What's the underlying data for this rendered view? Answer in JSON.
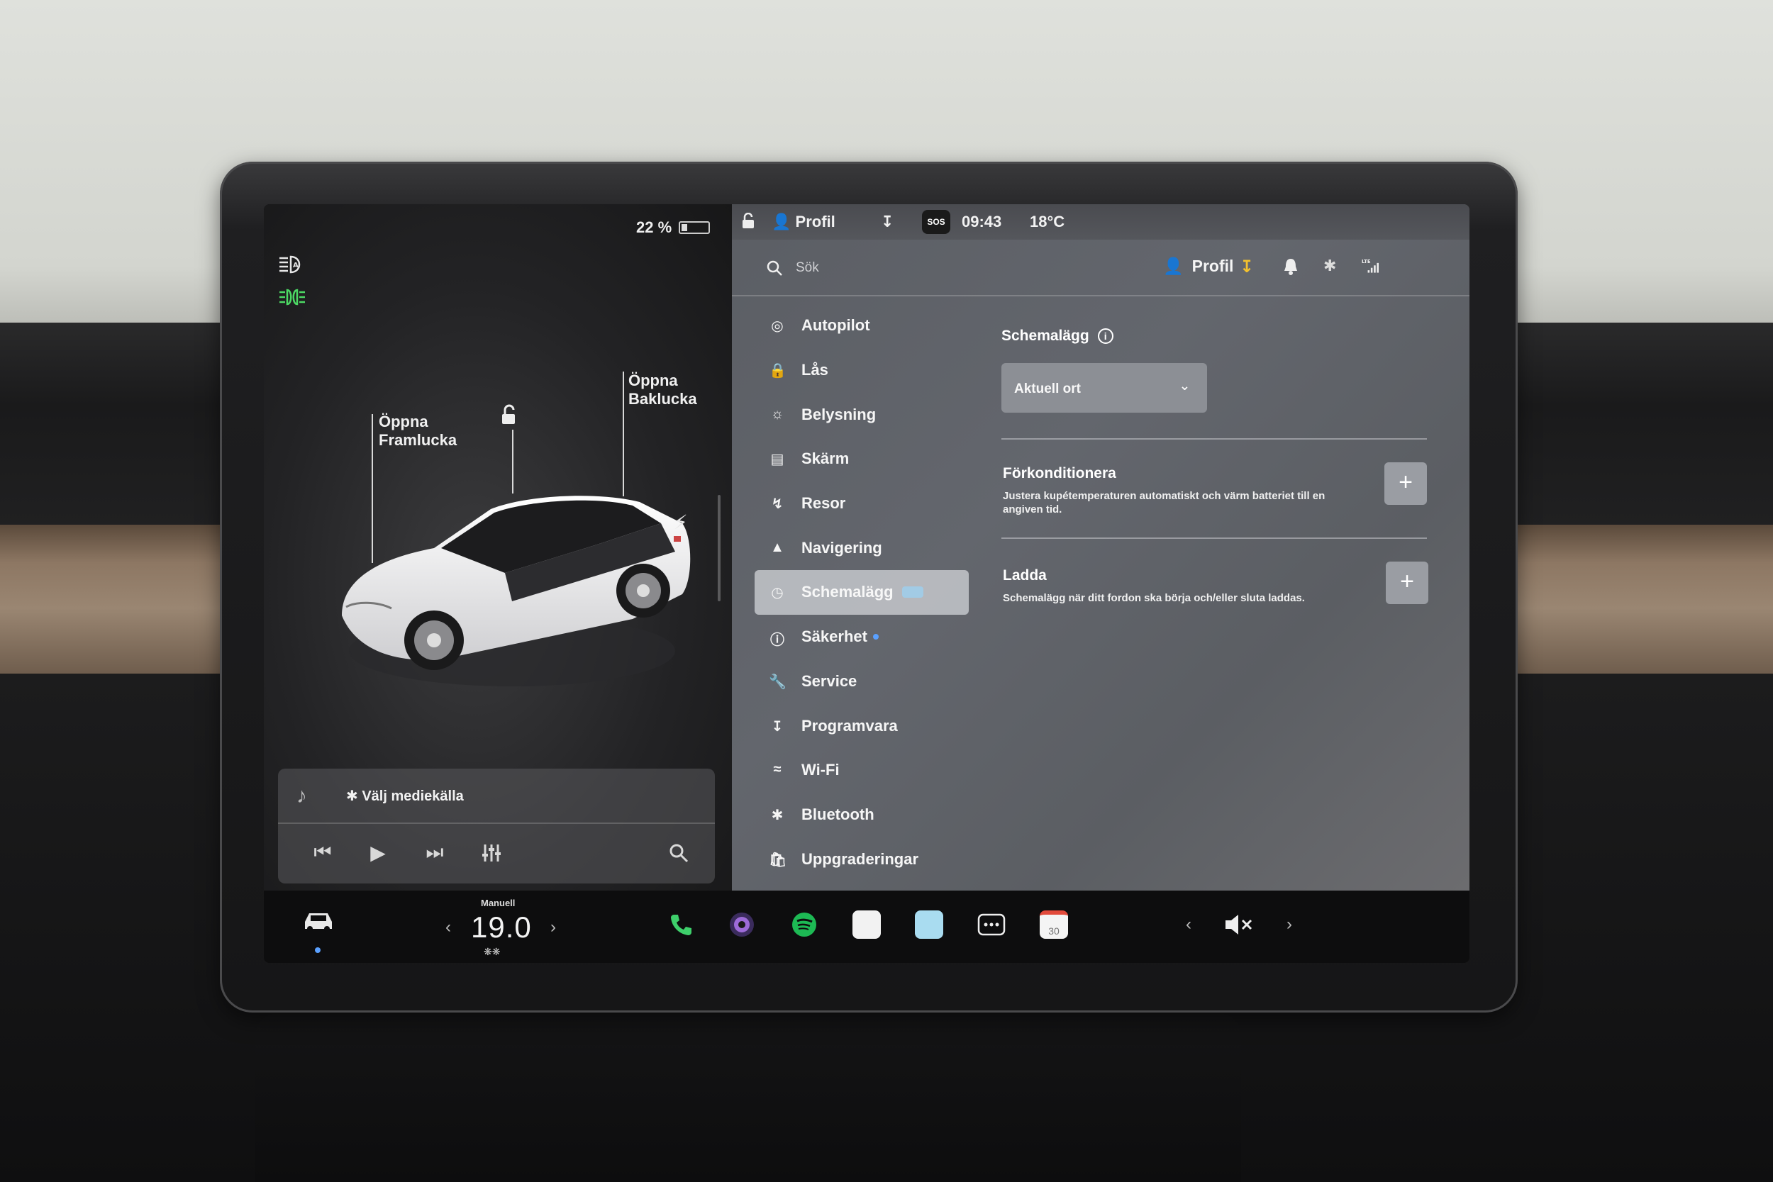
{
  "left_panel": {
    "battery_percent": "22 %",
    "battery_level": 0.22,
    "frunk_label": "Öppna\nFramlucka",
    "frunk_line1": "Öppna",
    "frunk_line2": "Framlucka",
    "trunk_line1": "Öppna",
    "trunk_line2": "Baklucka",
    "media": {
      "source_label": "Välj mediekälla"
    }
  },
  "status_bar": {
    "profile_label": "Profil",
    "time": "09:43",
    "temperature": "18°C",
    "sos_label": "SOS"
  },
  "top_bar": {
    "search_placeholder": "Sök",
    "profile_label": "Profil"
  },
  "nav": {
    "items": [
      {
        "label": "Autopilot",
        "icon": "steering-wheel-icon"
      },
      {
        "label": "Lås",
        "icon": "lock-icon"
      },
      {
        "label": "Belysning",
        "icon": "sun-icon"
      },
      {
        "label": "Skärm",
        "icon": "display-icon"
      },
      {
        "label": "Resor",
        "icon": "trips-icon"
      },
      {
        "label": "Navigering",
        "icon": "navigation-icon"
      },
      {
        "label": "Schemalägg",
        "icon": "clock-icon",
        "active": true
      },
      {
        "label": "Säkerhet",
        "icon": "safety-icon"
      },
      {
        "label": "Service",
        "icon": "wrench-icon"
      },
      {
        "label": "Programvara",
        "icon": "download-icon"
      },
      {
        "label": "Wi-Fi",
        "icon": "wifi-icon"
      },
      {
        "label": "Bluetooth",
        "icon": "bluetooth-icon"
      },
      {
        "label": "Uppgraderingar",
        "icon": "shopping-bag-icon"
      }
    ]
  },
  "schedule": {
    "title": "Schemalägg",
    "location_select": "Aktuell ort",
    "precondition": {
      "title": "Förkonditionera",
      "description": "Justera kupétemperaturen automatiskt och värm batteriet till en angiven tid."
    },
    "charge": {
      "title": "Ladda",
      "description": "Schemalägg när ditt fordon ska börja och/eller sluta laddas."
    }
  },
  "taskbar": {
    "climate_mode": "Manuell",
    "temperature": "19.0",
    "calendar_day": "30"
  },
  "colors": {
    "accent_blue": "#5aa0ff",
    "download_yellow": "#f3c12e",
    "spotify_green": "#1db954",
    "phone_green": "#3ecf6b"
  }
}
